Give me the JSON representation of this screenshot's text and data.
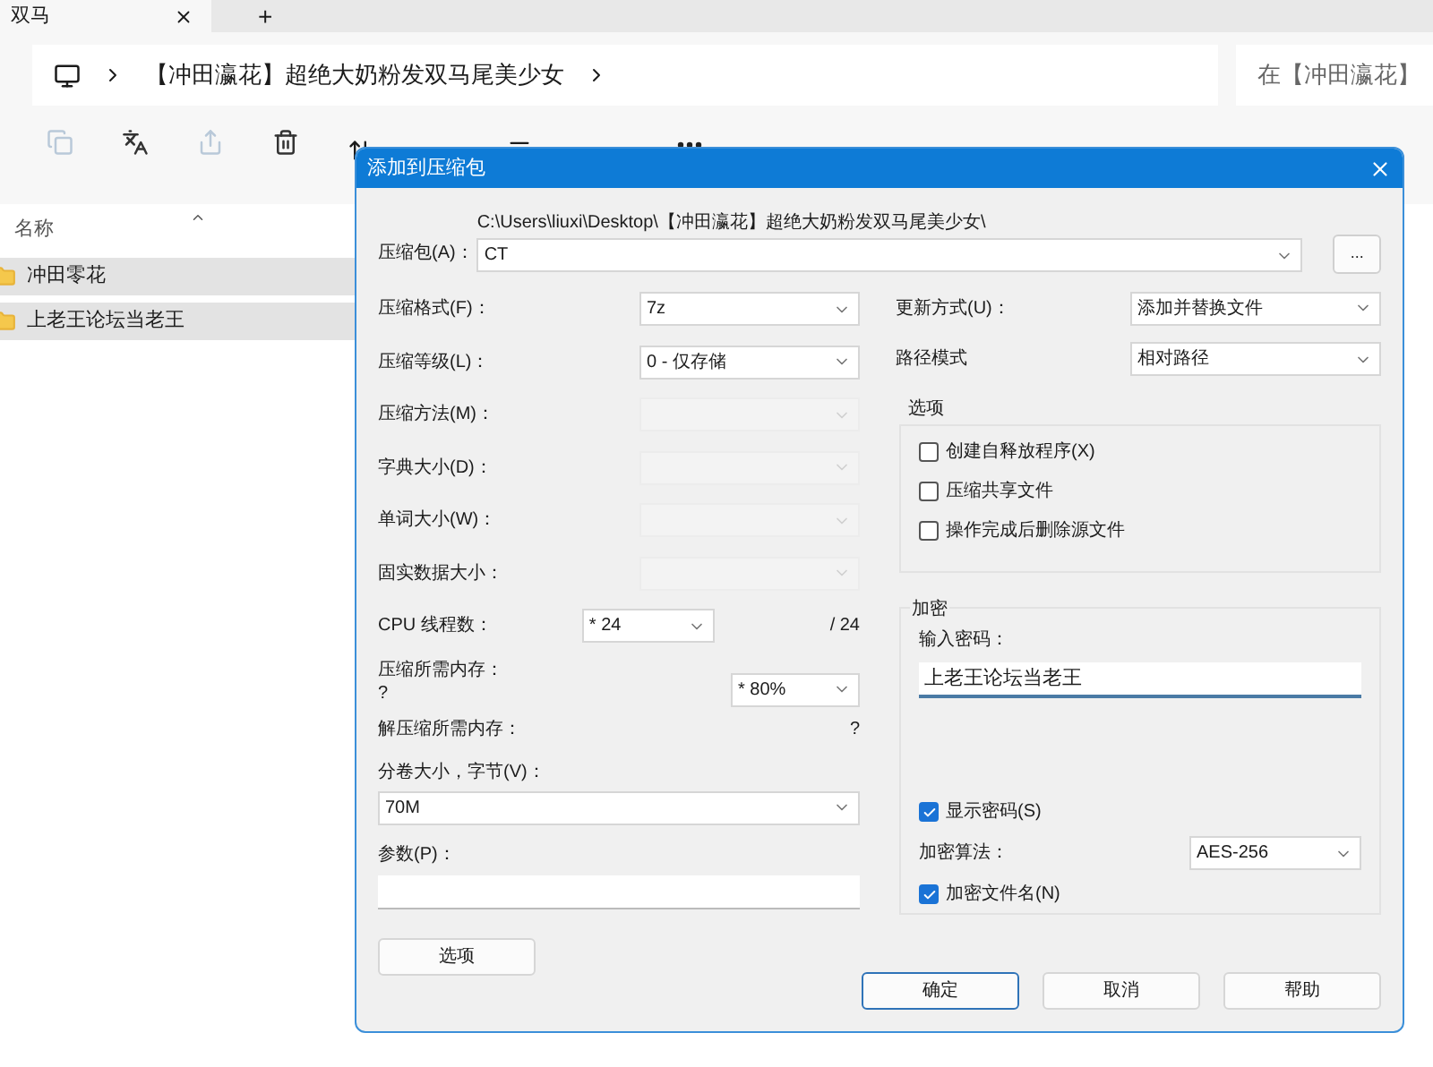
{
  "explorer": {
    "tab": {
      "title": "双马"
    },
    "new_tab": "+",
    "breadcrumb": [
      {
        "label": "【冲田瀛花】超绝大奶粉发双马尾美少女"
      }
    ],
    "search": {
      "placeholder": "在【冲田瀛花】"
    },
    "toolbar": [
      {
        "kind": "icon",
        "disabled": true
      },
      {
        "kind": "icon",
        "disabled": false
      },
      {
        "kind": "icon",
        "disabled": true
      },
      {
        "kind": "icon",
        "disabled": false
      }
    ],
    "column": "名称",
    "files": [
      {
        "name": "冲田零花",
        "selected": true
      },
      {
        "name": "上老王论坛当老王",
        "selected": true
      }
    ]
  },
  "dialog": {
    "title": "添加到压缩包",
    "archive": {
      "label": "压缩包(A)：",
      "path": "C:\\Users\\liuxi\\Desktop\\【冲田瀛花】超绝大奶粉发双马尾美少女\\",
      "value": "CT",
      "browse": "..."
    },
    "left": [
      {
        "kind": "select",
        "label": "压缩格式(F)：",
        "value": "7z",
        "disabled": false
      },
      {
        "kind": "select",
        "label": "压缩等级(L)：",
        "value": "0 - 仅存储",
        "disabled": false
      },
      {
        "kind": "select",
        "label": "压缩方法(M)：",
        "disabled": true
      },
      {
        "kind": "select",
        "label": "字典大小(D)：",
        "disabled": true
      },
      {
        "kind": "select",
        "label": "单词大小(W)：",
        "disabled": true
      },
      {
        "kind": "select",
        "label": "固实数据大小：",
        "disabled": true
      },
      {
        "kind": "threads",
        "label": "CPU 线程数：",
        "value": "* 24",
        "suffix": "/ 24",
        "disabled": false
      },
      {
        "kind": "memory",
        "label": "压缩所需内存：",
        "note": "?",
        "value": "* 80%",
        "disabled": false
      },
      {
        "kind": "info",
        "label": "解压缩所需内存：",
        "note": "?"
      }
    ],
    "volume": {
      "label": "分卷大小，字节(V)：",
      "value": "70M"
    },
    "params": {
      "label": "参数(P)："
    },
    "options_button": "选项",
    "update": {
      "label": "更新方式(U)：",
      "value": "添加并替换文件"
    },
    "path_mode": {
      "label": "路径模式",
      "value": "相对路径"
    },
    "options": {
      "title": "选项",
      "items": [
        {
          "label": "创建自释放程序(X)",
          "checked": false
        },
        {
          "label": "压缩共享文件",
          "checked": false
        },
        {
          "label": "操作完成后删除源文件",
          "checked": false
        }
      ]
    },
    "encryption": {
      "title": "加密",
      "password_label": "输入密码：",
      "password": "上老王论坛当老王",
      "show_password": {
        "label": "显示密码(S)",
        "checked": true
      },
      "method_label": "加密算法：",
      "method": "AES-256",
      "encrypt_names": {
        "label": "加密文件名(N)",
        "checked": true
      }
    },
    "buttons": [
      {
        "label": "确定",
        "default": true
      },
      {
        "label": "取消",
        "default": false
      },
      {
        "label": "帮助",
        "default": false
      }
    ]
  }
}
